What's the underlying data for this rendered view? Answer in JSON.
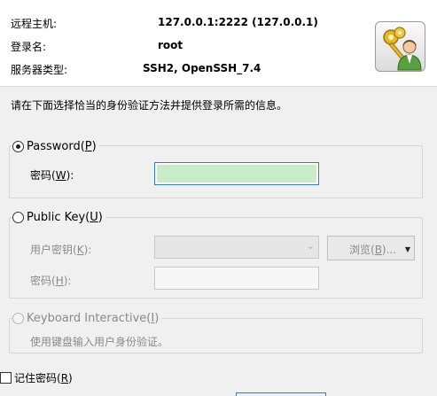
{
  "header": {
    "host_label": "远程主机:",
    "host_value": "127.0.0.1:2222 (127.0.0.1)",
    "login_label": "登录名:",
    "login_value": "root",
    "server_type_label": "服务器类型:",
    "server_type_value": "SSH2, OpenSSH_7.4",
    "icon": "keys-user-icon"
  },
  "instruction": "请在下面选择恰当的身份验证方法并提供登录所需的信息。",
  "password": {
    "label_prefix": "Password(",
    "label_key": "P",
    "label_suffix": ")",
    "selected": true,
    "field_label_prefix": "密码(",
    "field_label_key": "W",
    "field_label_suffix": "):",
    "value": ""
  },
  "public_key": {
    "label_prefix": "Public Key(",
    "label_key": "U",
    "label_suffix": ")",
    "selected": false,
    "user_key_label_prefix": "用户密钥(",
    "user_key_label_key": "K",
    "user_key_label_suffix": "):",
    "user_key_value": "",
    "browse_prefix": "浏览(",
    "browse_key": "B",
    "browse_suffix": ")...",
    "passphrase_label_prefix": "密码(",
    "passphrase_label_key": "H",
    "passphrase_label_suffix": "):",
    "passphrase_value": ""
  },
  "keyboard_interactive": {
    "label_prefix": "Keyboard Interactive(",
    "label_key": "I",
    "label_suffix": ")",
    "selected": false,
    "enabled": false,
    "description": "使用键盘输入用户身份验证。"
  },
  "remember_password": {
    "label_prefix": "记住密码(",
    "label_key": "R",
    "label_suffix": ")",
    "checked": false
  },
  "colors": {
    "password_fill": "#c8ecc8",
    "focus_border": "#3a79c4",
    "disabled_text": "#8a8a8a"
  }
}
